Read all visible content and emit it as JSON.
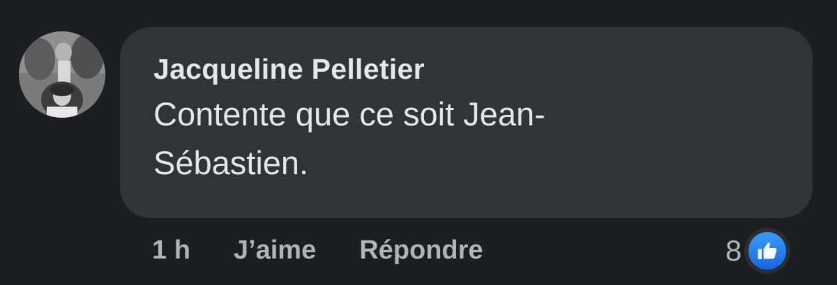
{
  "comment": {
    "author": "Jacqueline Pelletier",
    "text": "Contente que ce soit Jean-Sébastien.",
    "avatar_icon": "profile-photo",
    "actions": {
      "time": "1 h",
      "like_label": "J’aime",
      "reply_label": "Répondre"
    },
    "reactions": {
      "count": "8",
      "icon": "thumbs-up-icon",
      "icon_color": "#1877f2"
    }
  },
  "colors": {
    "background": "#1c1d1f",
    "bubble": "#323335",
    "primary_text": "#e4e6eb",
    "secondary_text": "#b0b3b8"
  }
}
